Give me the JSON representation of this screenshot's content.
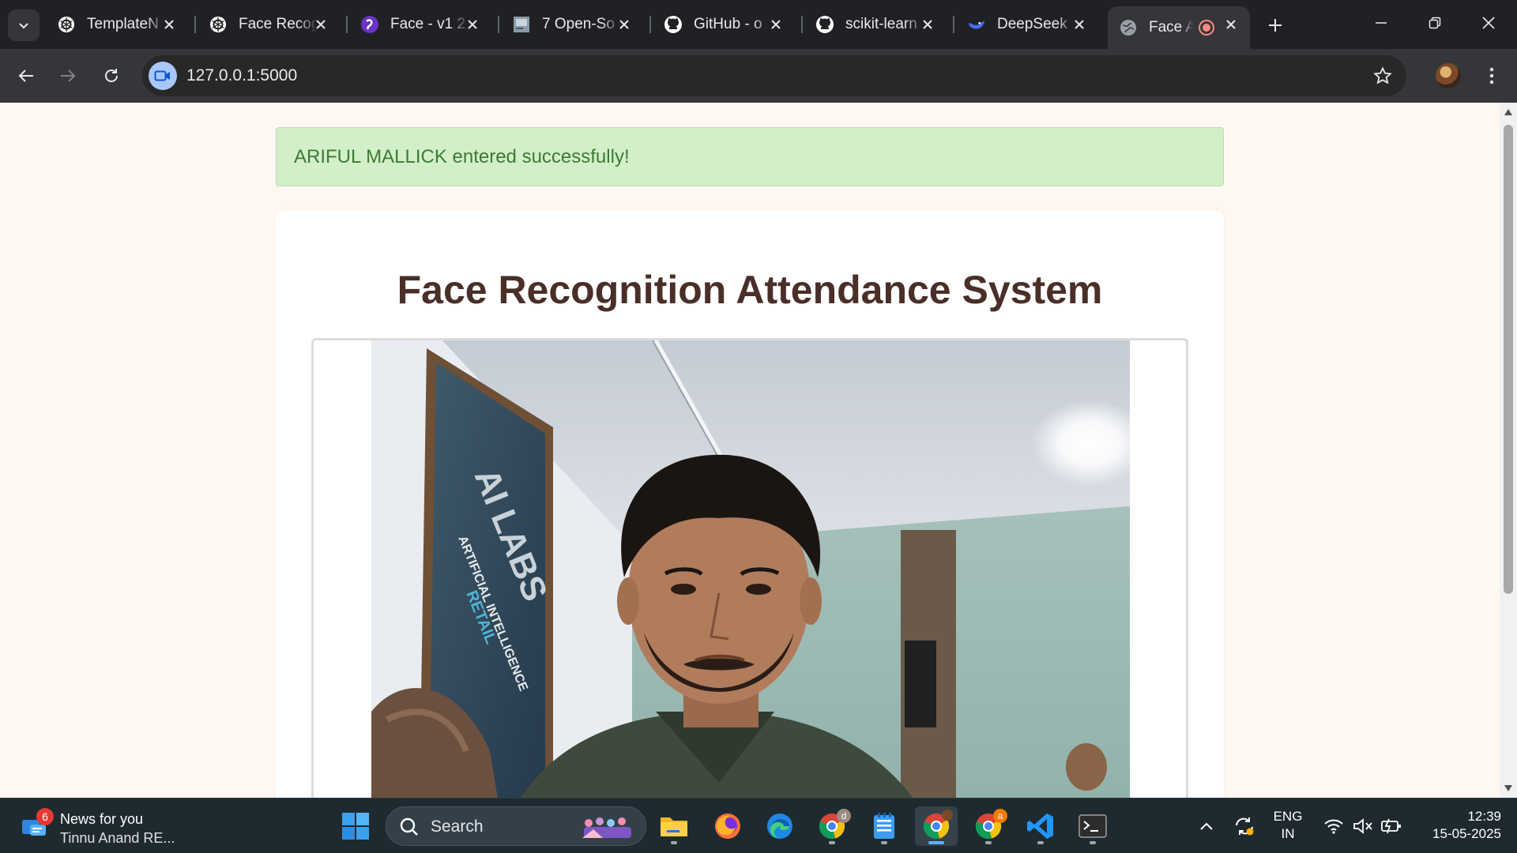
{
  "browser": {
    "tabs": [
      {
        "title": "TemplateN",
        "icon": "openai-icon"
      },
      {
        "title": "Face Recog",
        "icon": "openai-icon"
      },
      {
        "title": "Face - v1 2",
        "icon": "roboflow-icon"
      },
      {
        "title": "7 Open-So",
        "icon": "article-icon"
      },
      {
        "title": "GitHub - o",
        "icon": "github-icon"
      },
      {
        "title": "scikit-learn",
        "icon": "github-icon"
      },
      {
        "title": "DeepSeek",
        "icon": "deepseek-icon"
      },
      {
        "title": "Face A",
        "icon": "globe-icon",
        "active": true,
        "recording": true
      }
    ],
    "url": "127.0.0.1:5000"
  },
  "page": {
    "alert_message": "ARIFUL MALLICK entered successfully!",
    "title": "Face Recognition Attendance System",
    "video_feed": "webcam-feed"
  },
  "taskbar": {
    "news": {
      "badge": "6",
      "title": "News for you",
      "subtitle": "Tinnu Anand RE..."
    },
    "search_label": "Search",
    "chrome_profile_badges": [
      "d",
      "a"
    ],
    "tray": {
      "lang_line1": "ENG",
      "lang_line2": "IN",
      "time": "12:39",
      "date": "15-05-2025"
    }
  },
  "colors": {
    "alert_bg": "#d3efca",
    "alert_text": "#3c7a34",
    "title_text": "#4a2e28",
    "page_bg": "#fff7f2"
  }
}
